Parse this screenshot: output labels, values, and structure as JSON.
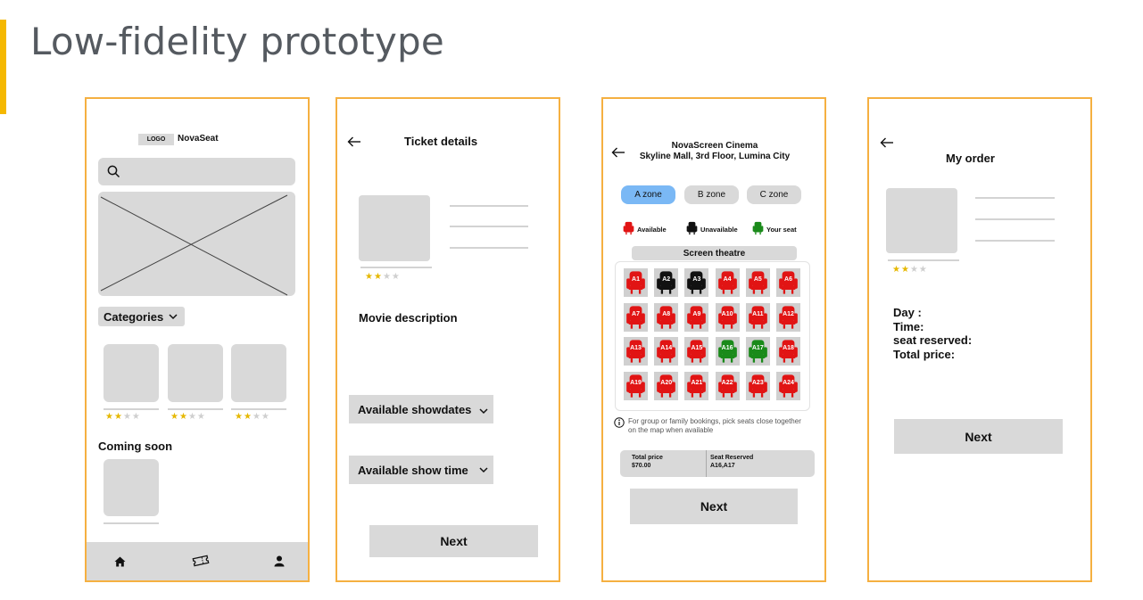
{
  "slide": {
    "title": "Low-fidelity prototype",
    "accent_color": "#f5b800",
    "frame_color": "#f5b041"
  },
  "screen1": {
    "logo": "LOGO",
    "app_name": "NovaSeat",
    "search_icon": "search-icon",
    "categories_label": "Categories",
    "movies": [
      {
        "rating": 2,
        "max": 5
      },
      {
        "rating": 2,
        "max": 5
      },
      {
        "rating": 2,
        "max": 5
      }
    ],
    "coming_soon_label": "Coming soon",
    "nav_icons": [
      "home-icon",
      "ticket-icon",
      "user-icon"
    ]
  },
  "screen2": {
    "title": "Ticket details",
    "rating": 2,
    "rating_max": 4,
    "description_label": "Movie description",
    "showdates_label": "Available showdates",
    "showtime_label": "Available show time",
    "next_label": "Next"
  },
  "screen3": {
    "cinema_name": "NovaScreen Cinema",
    "cinema_location": "Skyline Mall, 3rd Floor, Lumina City",
    "zones": [
      {
        "label": "A zone",
        "active": true
      },
      {
        "label": "B zone",
        "active": false
      },
      {
        "label": "C zone",
        "active": false
      }
    ],
    "legend": [
      {
        "label": "Available",
        "color": "#e11414"
      },
      {
        "label": "Unavailable",
        "color": "#111111"
      },
      {
        "label": "Your seat",
        "color": "#1a8a1a"
      }
    ],
    "screen_label": "Screen theatre",
    "seats": [
      {
        "label": "A1",
        "status": "available"
      },
      {
        "label": "A2",
        "status": "unavailable"
      },
      {
        "label": "A3",
        "status": "unavailable"
      },
      {
        "label": "A4",
        "status": "available"
      },
      {
        "label": "A5",
        "status": "available"
      },
      {
        "label": "A6",
        "status": "available"
      },
      {
        "label": "A7",
        "status": "available"
      },
      {
        "label": "A8",
        "status": "available"
      },
      {
        "label": "A9",
        "status": "available"
      },
      {
        "label": "A10",
        "status": "available"
      },
      {
        "label": "A11",
        "status": "available"
      },
      {
        "label": "A12",
        "status": "available"
      },
      {
        "label": "A13",
        "status": "available"
      },
      {
        "label": "A14",
        "status": "available"
      },
      {
        "label": "A15",
        "status": "available"
      },
      {
        "label": "A16",
        "status": "selected"
      },
      {
        "label": "A17",
        "status": "selected"
      },
      {
        "label": "A18",
        "status": "available"
      },
      {
        "label": "A19",
        "status": "available"
      },
      {
        "label": "A20",
        "status": "available"
      },
      {
        "label": "A21",
        "status": "available"
      },
      {
        "label": "A22",
        "status": "available"
      },
      {
        "label": "A23",
        "status": "available"
      },
      {
        "label": "A24",
        "status": "available"
      }
    ],
    "note": "For group or family bookings, pick seats close together on the map when available",
    "total_price_label": "Total price",
    "total_price": "$70.00",
    "seat_reserved_label": "Seat Reserved",
    "seat_reserved": "A16,A17",
    "next_label": "Next"
  },
  "screen4": {
    "title": "My order",
    "rating": 2,
    "rating_max": 4,
    "day_label": "Day :",
    "time_label": "Time:",
    "seat_label": "seat reserved:",
    "total_label": "Total price:",
    "next_label": "Next"
  }
}
